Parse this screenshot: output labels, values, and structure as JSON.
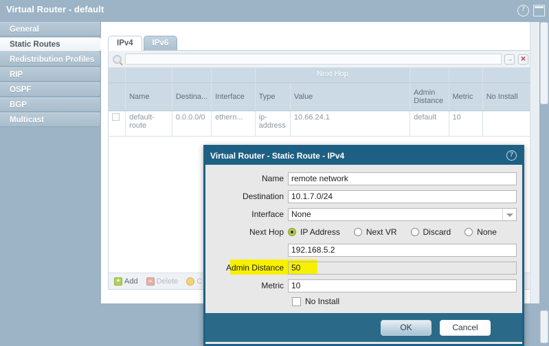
{
  "header": {
    "title": "Virtual Router - default",
    "help_icon": "?",
    "window_icon": "window-icon"
  },
  "sidebar": {
    "items": [
      {
        "label": "General",
        "active": false
      },
      {
        "label": "Static Routes",
        "active": true
      },
      {
        "label": "Redistribution Profiles",
        "active": false
      },
      {
        "label": "RIP",
        "active": false
      },
      {
        "label": "OSPF",
        "active": false
      },
      {
        "label": "BGP",
        "active": false
      },
      {
        "label": "Multicast",
        "active": false
      }
    ]
  },
  "tabs": [
    {
      "label": "IPv4",
      "active": true
    },
    {
      "label": "IPv6",
      "active": false
    }
  ],
  "filter": {
    "value": "",
    "placeholder": "",
    "go_label": "→",
    "clear_label": "✕"
  },
  "table": {
    "group_header": "Next Hop",
    "columns": [
      "",
      "Name",
      "Destina...",
      "Interface",
      "Type",
      "Value",
      "Admin Distance",
      "Metric",
      "No Install"
    ],
    "rows": [
      {
        "checked": false,
        "name": "default-route",
        "destination": "0.0.0.0/0",
        "interface": "ethern...",
        "type": "ip-address",
        "value": "10.66.24.1",
        "admin_distance": "default",
        "metric": "10",
        "no_install": ""
      }
    ]
  },
  "grid_footer": {
    "add_label": "Add",
    "delete_label": "Delete",
    "clone_label": "C"
  },
  "dialog": {
    "title": "Virtual Router - Static Route - IPv4",
    "help_icon": "?",
    "fields": {
      "name_label": "Name",
      "name_value": "remote network",
      "destination_label": "Destination",
      "destination_value": "10.1.7.0/24",
      "interface_label": "Interface",
      "interface_value": "None",
      "next_hop_label": "Next Hop",
      "next_hop_options": [
        {
          "label": "IP Address",
          "selected": true
        },
        {
          "label": "Next VR",
          "selected": false
        },
        {
          "label": "Discard",
          "selected": false
        },
        {
          "label": "None",
          "selected": false
        }
      ],
      "next_hop_value": "192.168.5.2",
      "admin_distance_label": "Admin Distance",
      "admin_distance_value": "50",
      "metric_label": "Metric",
      "metric_value": "10",
      "no_install_label": "No Install",
      "no_install_checked": false
    },
    "ok_label": "OK",
    "cancel_label": "Cancel"
  },
  "colors": {
    "page_background": "#9cb4c5",
    "dialog_header": "#1e6083",
    "dialog_footer": "#2a6a88",
    "highlight": "#f7f000",
    "radio_selected": "#b8cc46"
  }
}
